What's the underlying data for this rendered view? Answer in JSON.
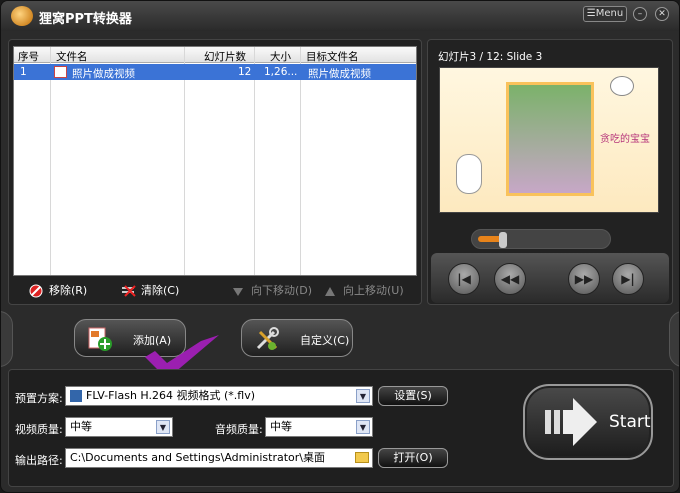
{
  "app": {
    "title": "狸窝PPT转换器",
    "menu_label": "☰Menu"
  },
  "table": {
    "headers": [
      "序号",
      "文件名",
      "幻灯片数",
      "大小",
      "目标文件名"
    ],
    "rows": [
      {
        "index": "1",
        "filename": "照片做成视频",
        "slides": "12",
        "size": "1,26...",
        "target": "照片做成视频"
      }
    ]
  },
  "actions": {
    "remove": "移除(R)",
    "clear": "清除(C)",
    "move_down": "向下移动(D)",
    "move_up": "向上移动(U)"
  },
  "preview": {
    "slide_label": "幻灯片3 / 12: Slide 3",
    "slide_caption": "贪吃的宝宝",
    "progress": 0.2
  },
  "buttons": {
    "add": "添加(A)",
    "custom": "自定义(C)",
    "settings": "设置(S)",
    "open": "打开(O)",
    "start": "Start"
  },
  "form": {
    "preset_label": "预置方案:",
    "preset_value": "FLV-Flash H.264 视频格式 (*.flv)",
    "video_quality_label": "视频质量:",
    "video_quality_value": "中等",
    "audio_quality_label": "音频质量:",
    "audio_quality_value": "中等",
    "output_label": "输出路径:",
    "output_value": "C:\\Documents and Settings\\Administrator\\桌面"
  },
  "colors": {
    "selection": "#3b73d6",
    "accent": "#e7831a",
    "check": "#9b1fb0"
  }
}
